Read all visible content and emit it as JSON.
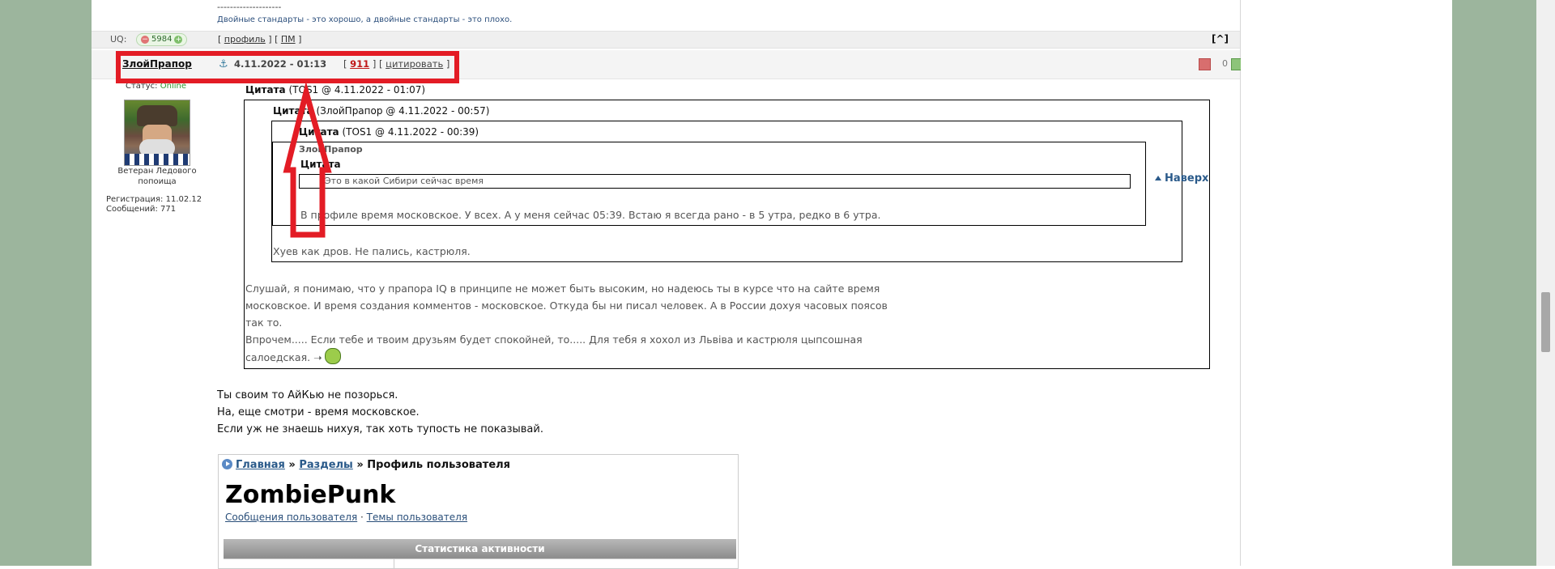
{
  "signature": {
    "dashes": "--------------------",
    "text": "Двойные стандарты - это хорошо, а двойные стандарты - это плохо."
  },
  "user_bar": {
    "uq_label": "UQ:",
    "uq_value": "5984",
    "profile_link": "профиль",
    "pm_link": "ПМ",
    "top_button": "[^]"
  },
  "post": {
    "author": "ЗлойПрапор",
    "date": "4.11.2022 - 01:13",
    "post_number": "911",
    "quote_action": "цитировать",
    "rating": "0"
  },
  "user_info": {
    "status_label": "Статус:",
    "status_value": "Online",
    "rank": "Ветеран Ледового попоища",
    "registration": "Регистрация: 11.02.12",
    "messages": "Сообщений: 771"
  },
  "quotes": {
    "q1_label": "Цитата",
    "q1_meta": "(TOS1 @ 4.11.2022 - 01:07)",
    "q2_label": "Цитата",
    "q2_meta": "(ЗлойПрапор @ 4.11.2022 - 00:57)",
    "q3_label": "Цитата",
    "q3_meta": "(TOS1 @ 4.11.2022 - 00:39)",
    "q4_author": "ЗлойПрапор",
    "q4_label": "Цитата",
    "q5_text": "Это в какой Сибири сейчас время",
    "q3_text": "В профиле время московское. У всех. А у меня сейчас 05:39. Встаю я всегда рано - в 5 утра, редко в 6 утра.",
    "q2_text": "Хуев как дров. Не пались, кастрюля.",
    "q1_lines": [
      "Слушай, я понимаю, что у прапора IQ в принципе не может быть высоким, но надеюсь ты в курсе что на сайте время",
      "московское. И время создания комментов - московское. Откуда бы ни писал человек. А в России дохуя часовых поясов",
      "так то.",
      "Впрочем..... Если тебе и твоим друзьям будет спокойней, то..... Для тебя я хохол из Львiва и кастрюля цыпсошная",
      "салоедская."
    ]
  },
  "body_lines": [
    "Ты своим то АйКью не позорься.",
    "На, еще смотри - время московское.",
    "Если уж не знаешь нихуя, так хоть тупость не показывай."
  ],
  "profile_card": {
    "crumb_home": "Главная",
    "crumb_sections": "Разделы",
    "crumb_current": "Профиль пользователя",
    "name": "ZombiePunk",
    "link_messages": "Сообщения пользователя",
    "separator": "·",
    "link_topics": "Темы пользователя",
    "stats_title": "Статистика активности"
  },
  "sidebar": {
    "to_top": "Наверх"
  },
  "colors": {
    "annotation_red": "#e31c25",
    "online_green": "#2d9a2d",
    "link_blue": "#2a5a8a",
    "side_green": "#9cb59d"
  }
}
